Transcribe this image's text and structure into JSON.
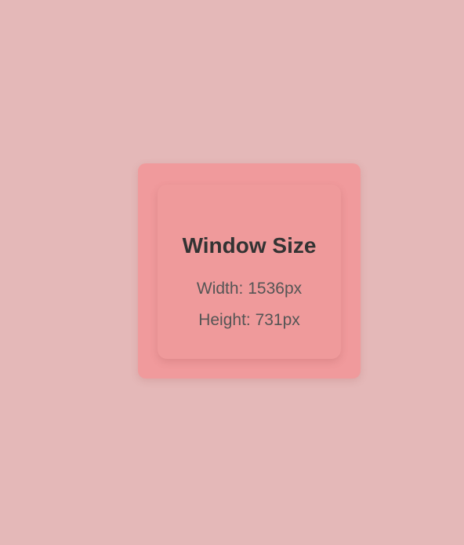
{
  "card": {
    "title": "Window Size",
    "width_text": "Width: 1536px",
    "height_text": "Height: 731px"
  },
  "colors": {
    "background": "#e4b8b8",
    "outer_card": "#f09a9c",
    "inner_card": "#ef9a9b",
    "title_text": "#333333",
    "body_text": "#555555"
  }
}
